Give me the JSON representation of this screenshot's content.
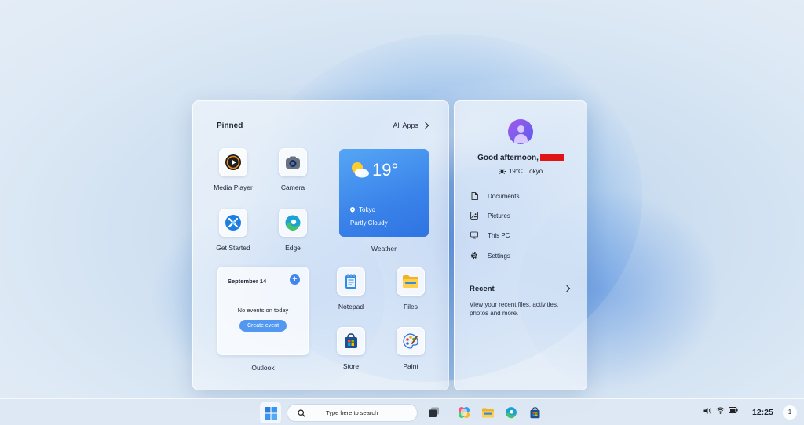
{
  "pinned": {
    "title": "Pinned",
    "all_apps": "All Apps",
    "apps": {
      "media_player": "Media Player",
      "camera": "Camera",
      "get_started": "Get Started",
      "edge": "Edge",
      "notepad": "Notepad",
      "files": "Files",
      "store": "Store",
      "paint": "Paint"
    }
  },
  "weather": {
    "temp": "19°",
    "location": "Tokyo",
    "condition": "Partly Cloudy",
    "label": "Weather"
  },
  "outlook": {
    "date": "September 14",
    "no_events": "No events on today",
    "create_event": "Create event",
    "label": "Outlook"
  },
  "profile": {
    "greeting": "Good afternoon,",
    "weather_line": "19°C  Tokyo"
  },
  "folders": {
    "documents": "Documents",
    "pictures": "Pictures",
    "this_pc": "This PC",
    "settings": "Settings"
  },
  "recent": {
    "title": "Recent",
    "description": "View your recent files, activities, photos and more."
  },
  "taskbar": {
    "search_placeholder": "Type here to search",
    "time": "12:25",
    "notification_count": "1"
  },
  "colors": {
    "accent": "#3e86ec",
    "weather_tile": "#3a83ea",
    "redaction": "#e11414"
  }
}
